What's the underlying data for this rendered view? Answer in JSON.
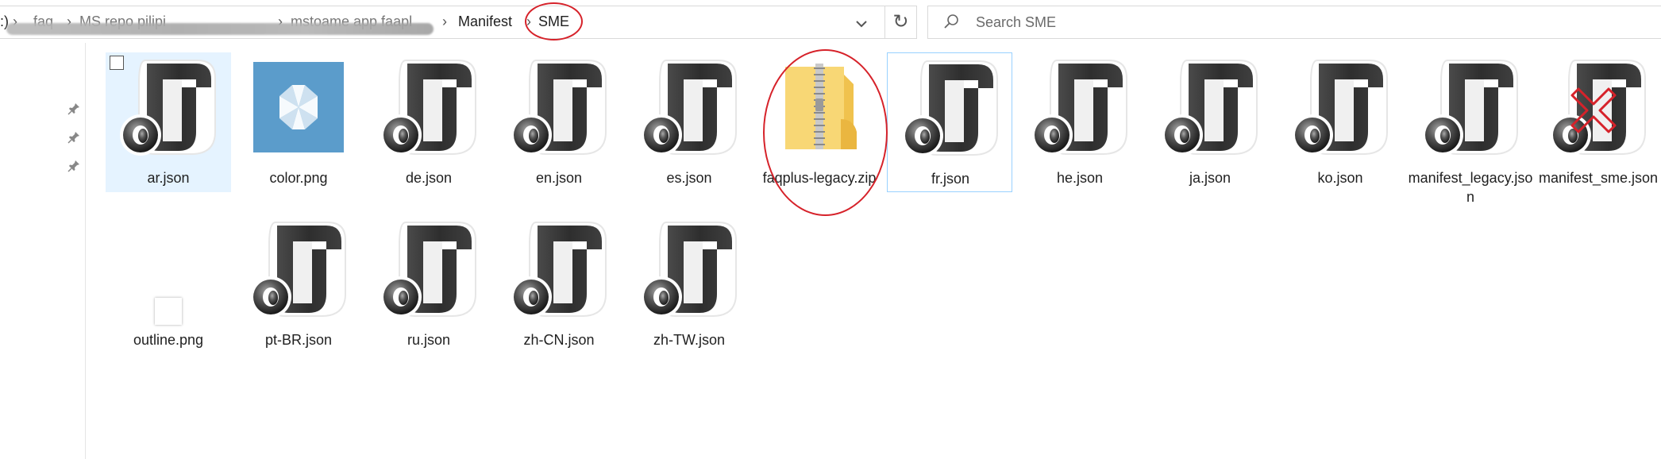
{
  "breadcrumb": {
    "items": [
      ":)",
      "faq",
      "MS repo pilipi",
      "mstoame app faapl",
      "Manifest",
      "SME"
    ],
    "current": "SME"
  },
  "search": {
    "placeholder": "Search SME"
  },
  "files": [
    {
      "name": "ar.json",
      "icon": "json-file-icon",
      "selected": true
    },
    {
      "name": "color.png",
      "icon": "png-color-thumbnail"
    },
    {
      "name": "de.json",
      "icon": "json-file-icon"
    },
    {
      "name": "en.json",
      "icon": "json-file-icon"
    },
    {
      "name": "es.json",
      "icon": "json-file-icon"
    },
    {
      "name": "faqplus-legacy.zip",
      "icon": "zip-folder-icon",
      "annotated": true
    },
    {
      "name": "fr.json",
      "icon": "json-file-icon",
      "focused": true
    },
    {
      "name": "he.json",
      "icon": "json-file-icon"
    },
    {
      "name": "ja.json",
      "icon": "json-file-icon"
    },
    {
      "name": "ko.json",
      "icon": "json-file-icon"
    },
    {
      "name": "manifest_legacy.json",
      "icon": "json-file-icon"
    },
    {
      "name": "manifest_sme.json",
      "icon": "json-file-icon",
      "marked_with_x": true
    },
    {
      "name": "outline.png",
      "icon": "png-outline-thumbnail"
    },
    {
      "name": "pt-BR.json",
      "icon": "json-file-icon"
    },
    {
      "name": "ru.json",
      "icon": "json-file-icon"
    },
    {
      "name": "zh-CN.json",
      "icon": "json-file-icon"
    },
    {
      "name": "zh-TW.json",
      "icon": "json-file-icon"
    }
  ],
  "colors": {
    "annotation_red": "#d6222a",
    "selection_bg": "#e5f3ff",
    "color_png_tile": "#5b9ccb",
    "zip_folder_yellow": "#f8d775"
  }
}
